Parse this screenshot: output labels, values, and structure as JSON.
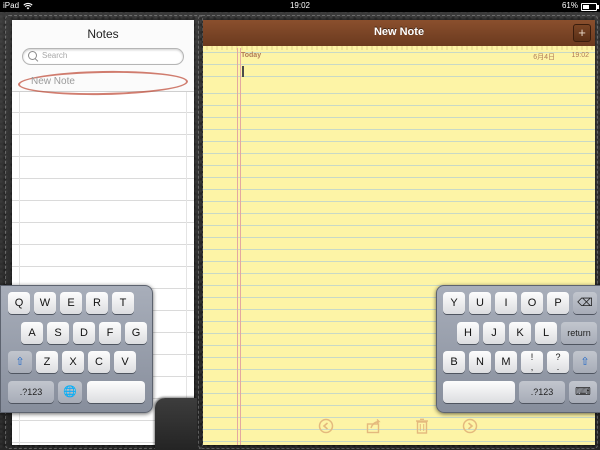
{
  "status_bar": {
    "device": "iPad",
    "time": "19:02",
    "battery": "61%",
    "wifi_icon": "wifi-icon",
    "battery_icon": "battery-icon"
  },
  "sidebar": {
    "title": "Notes",
    "search": {
      "placeholder": "Search",
      "icon": "search-icon"
    },
    "items": [
      {
        "label": "New Note",
        "selected": true
      }
    ]
  },
  "note": {
    "header_title": "New Note",
    "add_button_label": "+",
    "day_label": "Today",
    "date": "6月4日",
    "time": "19:02",
    "body": ""
  },
  "toolbar": {
    "icons": [
      "back-arrow-icon",
      "share-icon",
      "trash-icon",
      "forward-arrow-icon"
    ],
    "accent_color": "#e4b97d"
  },
  "keyboard_left": {
    "rows": [
      [
        "Q",
        "W",
        "E",
        "R",
        "T"
      ],
      [
        "A",
        "S",
        "D",
        "F",
        "G"
      ],
      [
        "⇧",
        "Z",
        "X",
        "C",
        "V"
      ],
      [
        ".?123",
        "🌐",
        ""
      ]
    ]
  },
  "keyboard_right": {
    "rows": [
      [
        "Y",
        "U",
        "I",
        "O",
        "P",
        "⌫"
      ],
      [
        "H",
        "J",
        "K",
        "L",
        "return"
      ],
      [
        "B",
        "N",
        "M",
        "!\n,",
        "?\n.",
        "⇧"
      ],
      [
        "",
        ".?123",
        "⌨"
      ]
    ]
  },
  "colors": {
    "header_brown": "#7a4525",
    "paper_yellow": "#fdf4a6",
    "shift_blue": "#1a64c8"
  }
}
